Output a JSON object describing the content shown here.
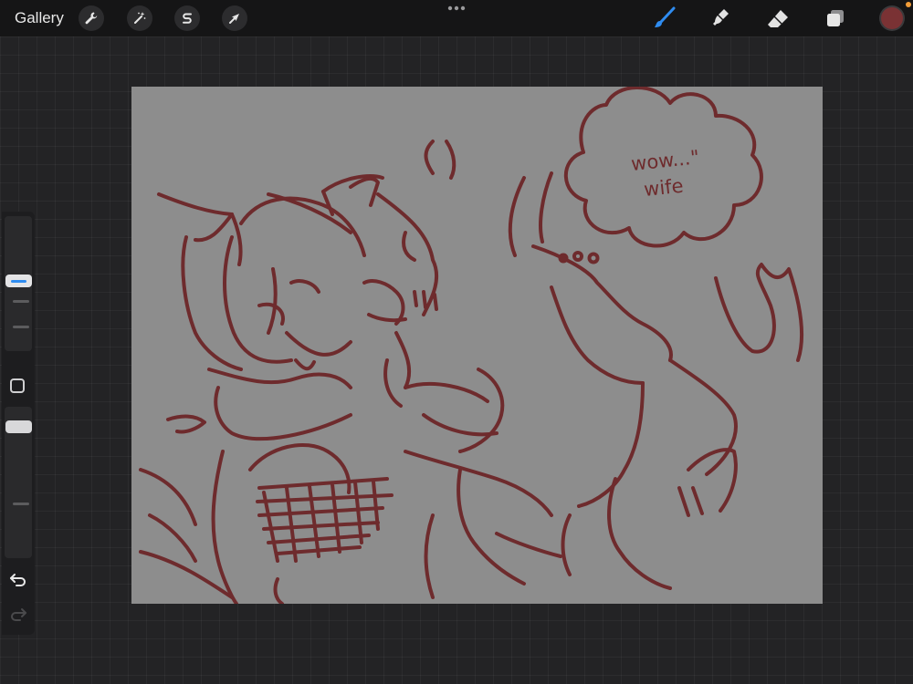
{
  "topbar": {
    "gallery_label": "Gallery",
    "left_tools": [
      {
        "name": "actions",
        "icon": "wrench-icon"
      },
      {
        "name": "adjustments",
        "icon": "magic-wand-icon"
      },
      {
        "name": "selection",
        "icon": "selection-s-icon"
      },
      {
        "name": "transform",
        "icon": "arrow-cursor-icon"
      }
    ],
    "more_icon": "more-dots-icon",
    "right_tools": [
      {
        "name": "brush",
        "icon": "brush-icon",
        "active": true
      },
      {
        "name": "smudge",
        "icon": "smudge-icon",
        "active": false
      },
      {
        "name": "eraser",
        "icon": "eraser-icon",
        "active": false
      },
      {
        "name": "layers",
        "icon": "layers-icon",
        "active": false
      }
    ]
  },
  "colors": {
    "current_color": "#7a3234",
    "accent": "#2f8cf0",
    "canvas_background": "#8d8d8d",
    "notification": "#f29d38",
    "stroke": "#6e2b2d"
  },
  "canvas": {
    "thought_bubble": {
      "line1": "wow...\"",
      "line2": "wife"
    }
  },
  "sidebar": {
    "undo_icon": "undo-icon",
    "redo_icon": "redo-icon",
    "modify_icon": "square-icon"
  }
}
